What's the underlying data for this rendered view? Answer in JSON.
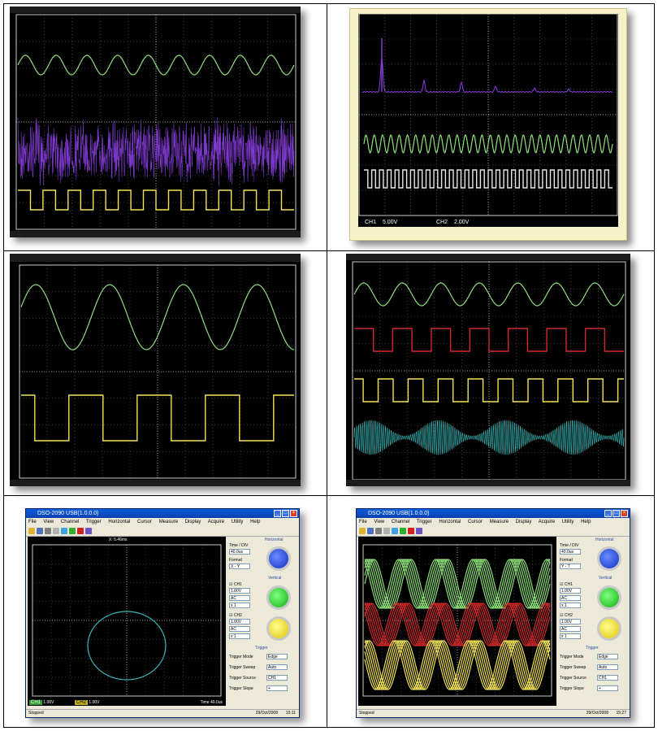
{
  "colors": {
    "ch_green": "#8ee07a",
    "ch_purple": "#8a3ee0",
    "ch_yellow": "#f2e35a",
    "ch_red": "#d02828",
    "ch_cyan": "#3ab4b4"
  },
  "panel_tr": {
    "ch1_label": "CH1",
    "ch1_value": "5.00V",
    "ch2_label": "CH2",
    "ch2_value": "2.00V"
  },
  "window": {
    "title": "DSO-2090 USB(1.0.0.0)",
    "menus": [
      "File",
      "View",
      "Channel",
      "Trigger",
      "Horizontal",
      "Cursor",
      "Measure",
      "Display",
      "Acquire",
      "Utility",
      "Help"
    ],
    "status_left": "Stopped",
    "xy_readout": "X: 5.46ms",
    "panel": {
      "horizontal": "Horizontal",
      "time_div": "Time / DIV",
      "time_value": "40.0us",
      "format": "Format",
      "vertical": "Vertical",
      "ch1": "CH1",
      "ch2": "CH2",
      "volt": "1.00V",
      "coupling": "AC",
      "probe": "x 1",
      "trigger": "Trigger",
      "trig_mode": "Trigger Mode",
      "trig_mode_val": "Edge",
      "trig_sweep": "Trigger Sweep",
      "trig_sweep_val": "Auto",
      "trig_source": "Trigger Source",
      "trig_source_val": "CH1",
      "trig_slope": "Trigger Slope",
      "trig_slope_val": "+"
    }
  },
  "win_bl": {
    "format_value": "X - Y",
    "ch1_bar": "1.00V",
    "ch2_bar": "1.00V",
    "time": "Time",
    "time_val": "40.0us",
    "date": "29/Oct/2008",
    "clock": "15:11"
  },
  "win_br": {
    "format_value": "Y - T",
    "date": "29/Oct/2008",
    "clock": "15:27"
  }
}
